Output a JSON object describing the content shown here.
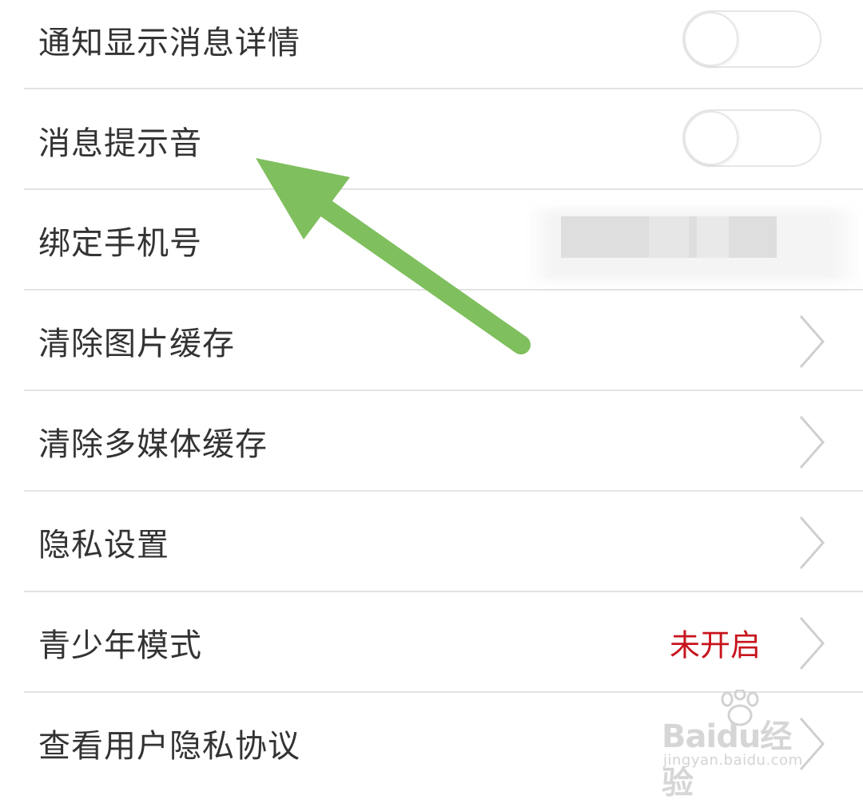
{
  "settings": {
    "items": [
      {
        "label": "通知显示消息详情",
        "control": "toggle",
        "on": false
      },
      {
        "label": "消息提示音",
        "control": "toggle",
        "on": false
      },
      {
        "label": "绑定手机号",
        "control": "chevron",
        "value": ""
      },
      {
        "label": "清除图片缓存",
        "control": "chevron"
      },
      {
        "label": "清除多媒体缓存",
        "control": "chevron"
      },
      {
        "label": "隐私设置",
        "control": "chevron"
      },
      {
        "label": "青少年模式",
        "control": "chevron",
        "status": "未开启"
      },
      {
        "label": "查看用户隐私协议",
        "control": "chevron"
      }
    ]
  },
  "colors": {
    "status_red": "#c8141e",
    "arrow_green": "#7fbf5e",
    "divider": "#e3e3e3",
    "label_text": "#333333"
  },
  "annotation": {
    "icon": "arrow-icon",
    "points_to": "消息提示音"
  },
  "watermark": {
    "brand": "Baidu经验",
    "site": "jingyan.baidu.com"
  }
}
